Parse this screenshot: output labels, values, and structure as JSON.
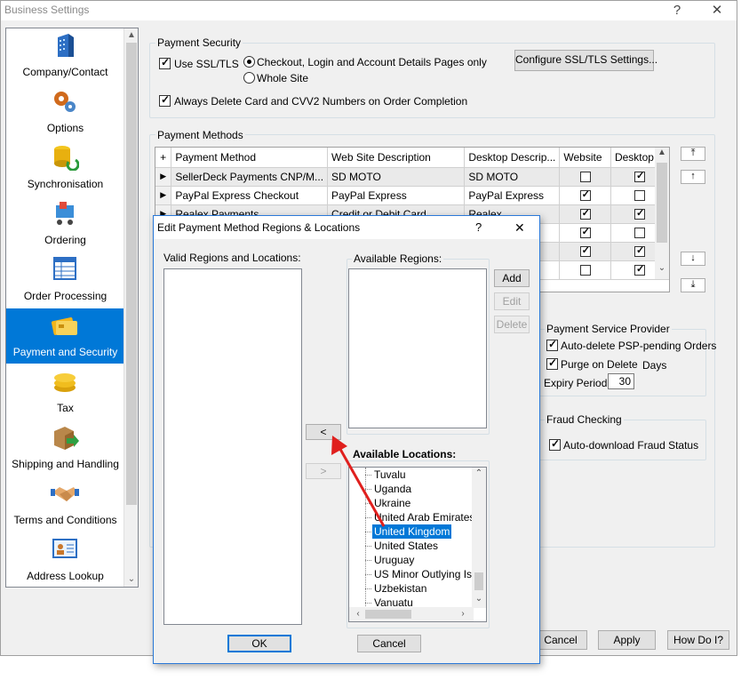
{
  "window": {
    "title": "Business Settings",
    "help_glyph": "?",
    "close_glyph": "✕"
  },
  "sidebar": {
    "items": [
      {
        "label": "Company/Contact",
        "icon": "building-icon"
      },
      {
        "label": "Options",
        "icon": "gears-icon"
      },
      {
        "label": "Synchronisation",
        "icon": "database-sync-icon"
      },
      {
        "label": "Ordering",
        "icon": "shopping-cart-icon"
      },
      {
        "label": "Order Processing",
        "icon": "spreadsheet-icon"
      },
      {
        "label": "Payment and Security",
        "icon": "credit-cards-icon"
      },
      {
        "label": "Tax",
        "icon": "coins-icon"
      },
      {
        "label": "Shipping and Handling",
        "icon": "package-arrow-icon"
      },
      {
        "label": "Terms and Conditions",
        "icon": "handshake-icon"
      },
      {
        "label": "Address Lookup",
        "icon": "contact-card-icon"
      }
    ],
    "selected": "Payment and Security"
  },
  "payment_security": {
    "legend": "Payment Security",
    "use_ssl_label": "Use SSL/TLS",
    "use_ssl_checked": true,
    "radio_checkout_label": "Checkout, Login and Account Details Pages only",
    "radio_whole_site_label": "Whole Site",
    "selected_radio": "Checkout, Login and Account Details Pages only",
    "configure_button": "Configure SSL/TLS Settings...",
    "always_delete_label": "Always Delete Card and CVV2 Numbers on Order Completion",
    "always_delete_checked": true
  },
  "payment_methods": {
    "legend": "Payment Methods",
    "add_glyph": "+",
    "columns": [
      "Payment Method",
      "Web Site Description",
      "Desktop Descrip...",
      "Website",
      "Desktop"
    ],
    "rows": [
      {
        "method": "SellerDeck Payments CNP/M...",
        "web": "SD MOTO",
        "desktop": "SD MOTO",
        "website_chk": false,
        "desktop_chk": true
      },
      {
        "method": "PayPal Express Checkout",
        "web": "PayPal Express",
        "desktop": "PayPal Express",
        "website_chk": true,
        "desktop_chk": false
      },
      {
        "method": "Realex Payments",
        "web": "Credit or Debit Card",
        "desktop": "Realex",
        "website_chk": true,
        "desktop_chk": true
      },
      {
        "method": "",
        "web": "",
        "desktop": "",
        "website_chk": true,
        "desktop_chk": false
      },
      {
        "method": "",
        "web": "",
        "desktop": "",
        "website_chk": true,
        "desktop_chk": true
      },
      {
        "method": "",
        "web": "",
        "desktop": "",
        "website_chk": false,
        "desktop_chk": true
      }
    ],
    "move_buttons": [
      "⤒",
      "↑",
      "↓",
      "⤓"
    ]
  },
  "psp": {
    "legend": "Payment Service Provider",
    "auto_delete_label": "Auto-delete PSP-pending Orders",
    "auto_delete_checked": true,
    "purge_label": "Purge on Delete",
    "purge_checked": true,
    "days_label": "Days",
    "expiry_label": "Expiry Period:",
    "expiry_value": "30"
  },
  "fraud": {
    "legend": "Fraud Checking",
    "auto_download_label": "Auto-download Fraud Status",
    "auto_download_checked": true
  },
  "bottom_buttons": {
    "cancel": "Cancel",
    "apply": "Apply",
    "how_do_i": "How Do I?"
  },
  "dialog": {
    "title": "Edit Payment Method Regions & Locations",
    "help_glyph": "?",
    "close_glyph": "✕",
    "valid_label": "Valid Regions and Locations:",
    "available_regions_legend": "Available Regions:",
    "add_button": "Add",
    "edit_button": "Edit",
    "delete_button": "Delete",
    "move_left_glyph": "<",
    "move_right_glyph": ">",
    "available_locations_legend": "Available Locations:",
    "locations": [
      "Tuvalu",
      "Uganda",
      "Ukraine",
      "United Arab Emirates",
      "United Kingdom",
      "United States",
      "Uruguay",
      "US Minor Outlying Islan",
      "Uzbekistan",
      "Vanuatu"
    ],
    "selected_location": "United Kingdom",
    "ok_button": "OK",
    "cancel_button": "Cancel"
  },
  "annotation": {
    "color": "#e0201e"
  }
}
